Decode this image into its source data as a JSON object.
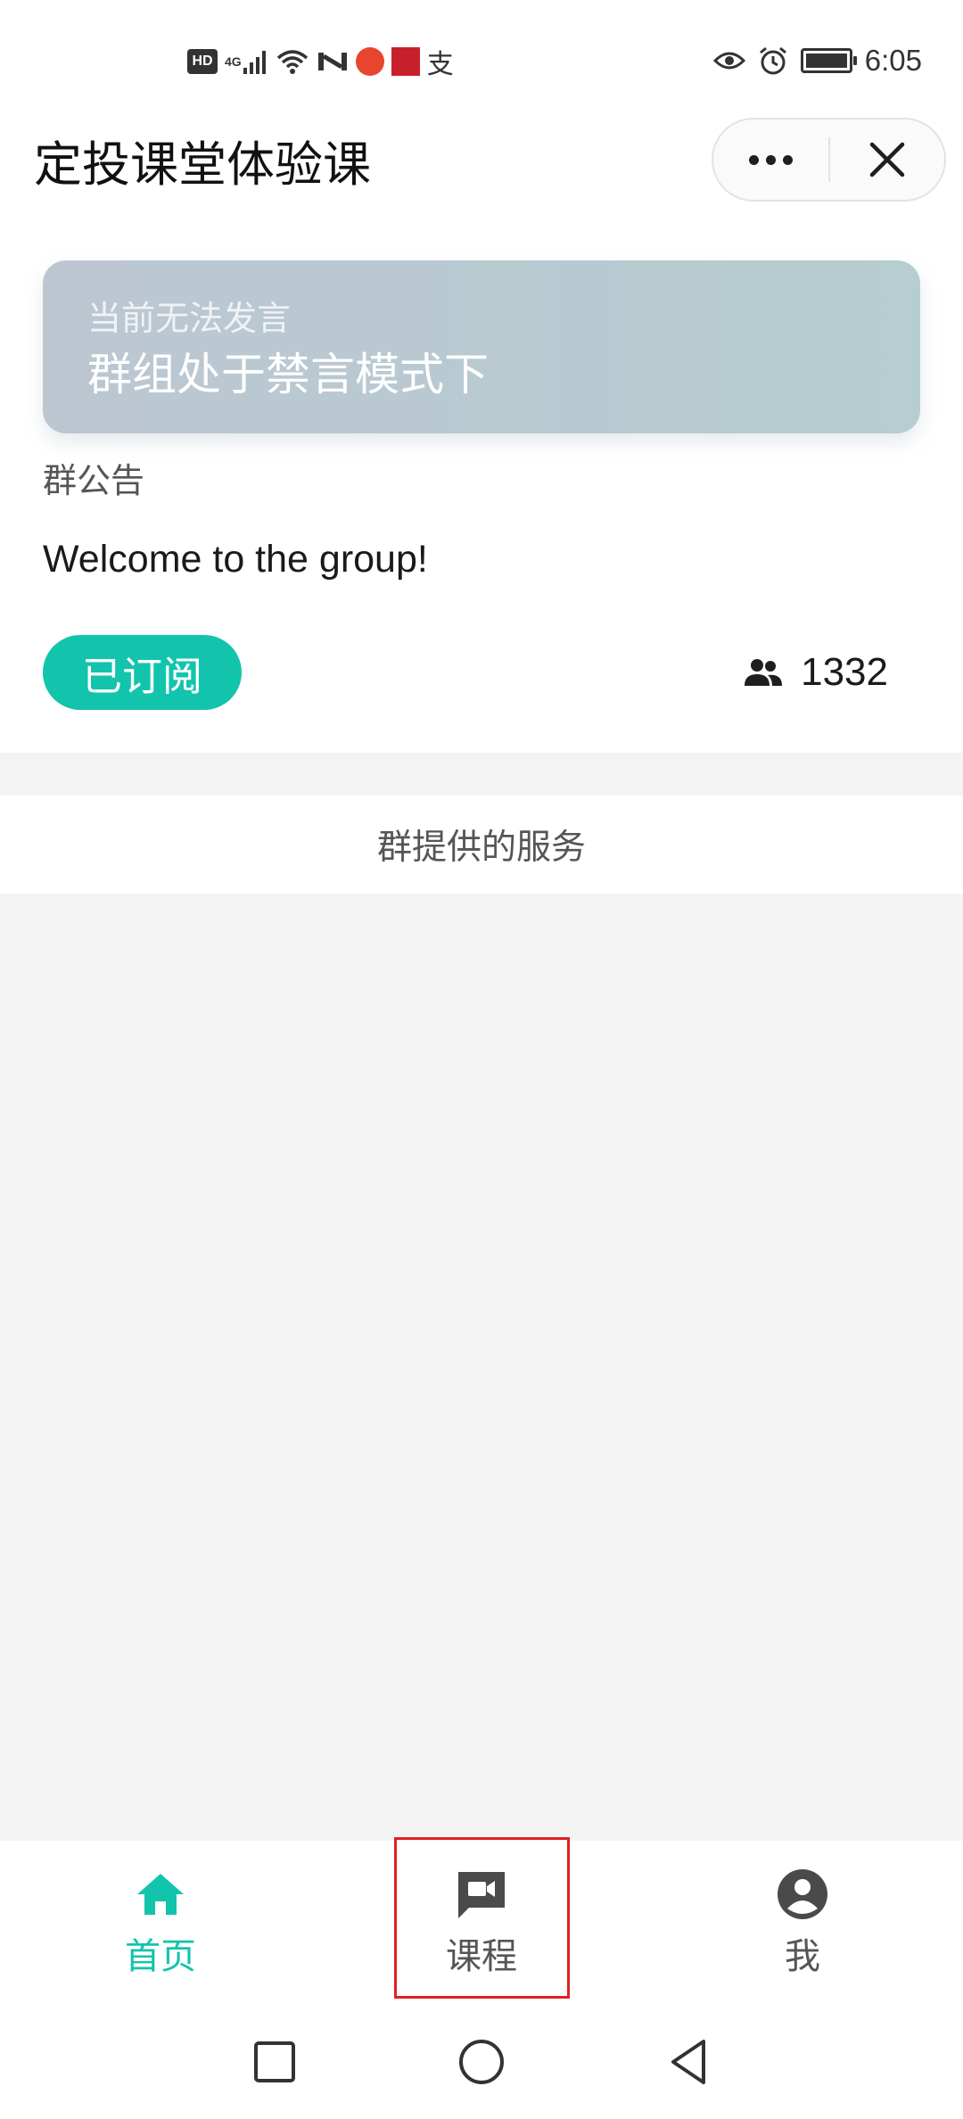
{
  "status_bar": {
    "left_icons": [
      {
        "icon": "hd-icon",
        "text": "HD"
      },
      {
        "icon": "4g-signal-icon",
        "text": "4G"
      },
      {
        "icon": "wifi-icon"
      },
      {
        "icon": "nfc-icon"
      },
      {
        "icon": "red-app-icon"
      },
      {
        "icon": "red-app-icon-2"
      },
      {
        "icon": "alipay-icon",
        "text": "支"
      }
    ],
    "right_icons": [
      {
        "icon": "eye-icon"
      },
      {
        "icon": "alarm-icon"
      },
      {
        "icon": "battery-icon"
      }
    ],
    "time": "6:05"
  },
  "header": {
    "title": "定投课堂体验课",
    "menu_icon": "more-dots-icon",
    "close_icon": "close-icon"
  },
  "group": {
    "mute_banner": {
      "subtitle": "当前无法发言",
      "message": "群组处于禁言模式下"
    },
    "notice_label": "群公告",
    "notice_text": "Welcome to the group!",
    "subscribe_label": "已订阅",
    "member_count": "1332",
    "member_icon": "members-icon"
  },
  "services": {
    "title": "群提供的服务"
  },
  "tabs": [
    {
      "label": "首页",
      "icon": "home-icon",
      "active": true
    },
    {
      "label": "课程",
      "icon": "video-chat-icon",
      "active": false,
      "highlighted": true
    },
    {
      "label": "我",
      "icon": "account-icon",
      "active": false
    }
  ],
  "system_nav": [
    {
      "icon": "recents-square-icon"
    },
    {
      "icon": "home-circle-icon"
    },
    {
      "icon": "back-triangle-icon"
    }
  ],
  "colors": {
    "accent": "#13c4ac",
    "highlight_border": "#e02020",
    "banner_gradient_start": "#bcc6d1",
    "banner_gradient_end": "#b6cdd1",
    "page_background": "#f3f3f3"
  }
}
